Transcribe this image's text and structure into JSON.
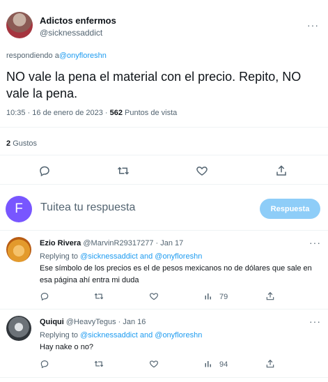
{
  "tweet": {
    "display_name": "Adictos enfermos",
    "handle": "@sicknessaddict",
    "more": "···",
    "replying_prefix": "respondiendo a",
    "replying_handle": "@onyfloreshn",
    "text": "NO vale la pena el material con el precio. Repito, NO vale la pena.",
    "time": "10:35 · 16 de enero de 2023 ·",
    "views_count": "562",
    "views_label": "Puntos de vista",
    "likes_count": "2",
    "likes_label": "Gustos"
  },
  "actions": {
    "icons": [
      "reply-icon",
      "retweet-icon",
      "like-icon",
      "share-icon"
    ]
  },
  "compose": {
    "avatar_letter": "F",
    "placeholder": "Tuitea tu respuesta",
    "button": "Respuesta",
    "avatar_color": "#7856ff",
    "button_color": "#8ecdf8"
  },
  "replies": [
    {
      "name": "Ezio Rivera",
      "handle": "@MarvinR29317277 · Jan 17",
      "more": "···",
      "replying_prefix": "Replying to",
      "replying_to": "@sicknessaddict and @onyfloreshn",
      "text": "Ese símbolo de los precios es el de pesos mexicanos no de dólares que sale en esa página ahí entra mi duda",
      "views": "79"
    },
    {
      "name": "Quiqui",
      "handle": "@HeavyTegus · Jan 16",
      "more": "···",
      "replying_prefix": "Replying to",
      "replying_to": "@sicknessaddict and @onyfloreshn",
      "text": "Hay nake o no?",
      "views": "94"
    }
  ],
  "colors": {
    "accent": "#1d9bf0",
    "secondary_text": "#536471",
    "divider": "#eff3f4"
  }
}
